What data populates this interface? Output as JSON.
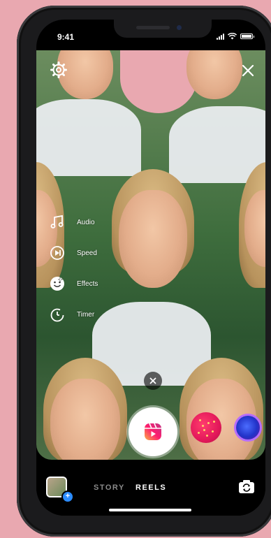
{
  "status_bar": {
    "time": "9:41"
  },
  "tools": [
    {
      "icon": "music-note-icon",
      "label": "Audio"
    },
    {
      "icon": "speed-icon",
      "label": "Speed"
    },
    {
      "icon": "face-effects-icon",
      "label": "Effects"
    },
    {
      "icon": "timer-icon",
      "label": "Timer"
    }
  ],
  "modes": {
    "story": "STORY",
    "reels": "REELS",
    "active": "REELS"
  },
  "colors": {
    "background": "#e9a8b0",
    "accent_blue": "#2b8cff",
    "effect_pink": "#e3185a"
  }
}
